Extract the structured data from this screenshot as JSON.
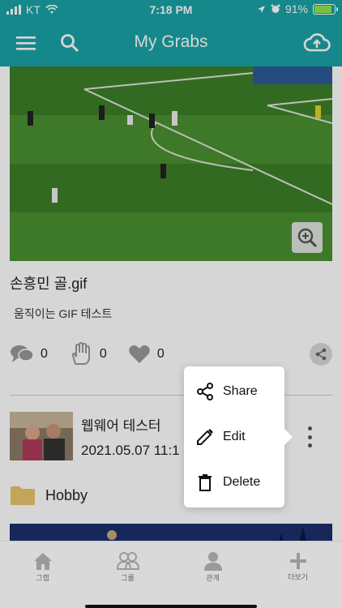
{
  "status_bar": {
    "carrier": "KT",
    "time": "7:18 PM",
    "battery": "91%",
    "battery_level": 0.91,
    "icons": [
      "signal-icon",
      "wifi-icon",
      "location-icon",
      "alarm-icon",
      "battery-charging-icon"
    ]
  },
  "header": {
    "title": "My Grabs",
    "menu_icon": "hamburger-menu-icon",
    "search_icon": "search-icon",
    "upload_icon": "cloud-upload-icon",
    "background": "#1aa3a6"
  },
  "post": {
    "title": "손흥민 골.gif",
    "description": "움직이는 GIF 테스트",
    "comments": "0",
    "grabs": "0",
    "likes": "0",
    "zoom_icon": "zoom-in-icon",
    "share_icon": "share-icon"
  },
  "next_post": {
    "author": "웹웨어 테스터",
    "date": "2021.05.07 11:1",
    "folder": "Hobby",
    "folder_color": "#e9c46a"
  },
  "context_menu": {
    "items": [
      {
        "label": "Share",
        "icon": "share-icon"
      },
      {
        "label": "Edit",
        "icon": "pencil-icon"
      },
      {
        "label": "Delete",
        "icon": "trash-icon"
      }
    ]
  },
  "tabbar": {
    "tabs": [
      {
        "label": "그랩",
        "icon": "home-icon"
      },
      {
        "label": "그룹",
        "icon": "group-icon"
      },
      {
        "label": "관계",
        "icon": "person-icon"
      },
      {
        "label": "더보기",
        "icon": "plus-icon"
      }
    ]
  }
}
